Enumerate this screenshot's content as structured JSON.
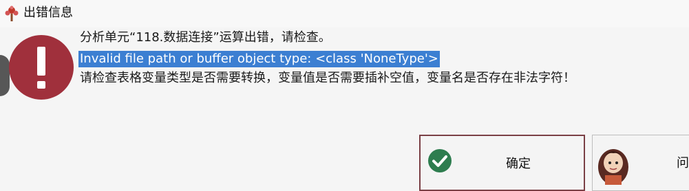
{
  "window": {
    "title": "出错信息"
  },
  "message": {
    "line1": "分析单元“118.数据连接”运算出错，请检查。",
    "line2": "Invalid file path or buffer object type: <class 'NoneType'>",
    "line3": "请检查表格变量类型是否需要转换，变量值是否需要插补空值，变量名是否存在非法字符！"
  },
  "buttons": {
    "ok_label": "确定",
    "ask_label": "问"
  },
  "icons": {
    "title": "tree-logo-icon",
    "error": "error-exclamation-icon",
    "ok": "check-circle-icon",
    "ask": "assistant-avatar-icon"
  },
  "colors": {
    "error_red": "#a0303c",
    "ok_green": "#2e7d4f",
    "selection_blue": "#3c7fd2",
    "ok_button_border": "#7a3f45"
  }
}
